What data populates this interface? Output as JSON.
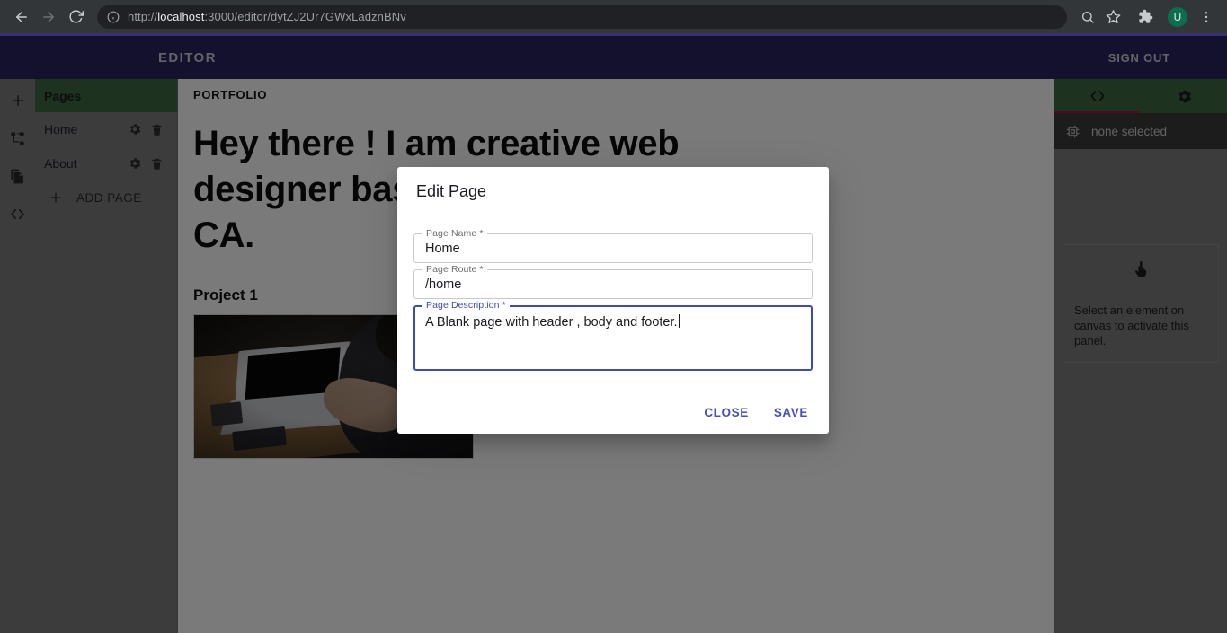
{
  "browser": {
    "back_icon": "back-arrow-icon",
    "forward_icon": "forward-arrow-icon",
    "reload_icon": "reload-icon",
    "site_info_icon": "info-circle-icon",
    "url_prefix": "http://",
    "url_host": "localhost",
    "url_rest": ":3000/editor/dytZJ2Ur7GWxLadznBNv",
    "url_full": "http://localhost:3000/editor/dytZJ2Ur7GWxLadznBNv",
    "search_icon": "search-icon",
    "bookmark_icon": "star-icon",
    "extensions_icon": "puzzle-piece-icon",
    "profile_initial": "U",
    "menu_icon": "kebab-menu-icon",
    "accent_color": "#3b3170",
    "toolbar_color": "#323639"
  },
  "app_header": {
    "title": "EDITOR",
    "sign_out_label": "SIGN OUT",
    "background": "#2b2560"
  },
  "icon_rail": {
    "items": [
      {
        "name": "add-icon",
        "label": "Add"
      },
      {
        "name": "sitemap-icon",
        "label": "Layers"
      },
      {
        "name": "file-copy-icon",
        "label": "Pages"
      },
      {
        "name": "code-icon",
        "label": "Code"
      }
    ]
  },
  "pages_panel": {
    "header": "Pages",
    "header_color": "#3e6b41",
    "pages": [
      {
        "name": "Home",
        "settings_icon": "gear-icon",
        "delete_icon": "trash-icon"
      },
      {
        "name": "About",
        "settings_icon": "gear-icon",
        "delete_icon": "trash-icon"
      }
    ],
    "add_page_label": "ADD PAGE",
    "add_page_icon": "plus-icon"
  },
  "canvas": {
    "section_label": "PORTFOLIO",
    "heading": "Hey there ! I am creative web designer based on San Francisco, CA.",
    "project_title": "Project 1",
    "project_image_alt": "person-working-on-laptop-photo"
  },
  "right_panel": {
    "tabs": [
      {
        "name": "code-tab",
        "icon": "code-icon",
        "active": true
      },
      {
        "name": "settings-tab",
        "icon": "gear-icon",
        "active": false
      }
    ],
    "tab_indicator_color": "#a8174a",
    "selection_icon": "chip-icon",
    "selection_text": "none selected",
    "placeholder_icon": "touch-pointer-icon",
    "placeholder_text": "Select an element on canvas to activate this panel."
  },
  "dialog": {
    "title": "Edit Page",
    "accent_color": "#3f4bb0",
    "fields": [
      {
        "label": "Page Name *",
        "value": "Home",
        "placeholder": "Page Name",
        "focused": false,
        "type": "text"
      },
      {
        "label": "Page Route *",
        "value": "/home",
        "placeholder": "Page Route",
        "focused": false,
        "type": "text"
      },
      {
        "label": "Page Description *",
        "value": "A Blank page with header , body and footer.",
        "placeholder": "Page Description",
        "focused": true,
        "type": "textarea"
      }
    ],
    "close_label": "CLOSE",
    "save_label": "SAVE"
  }
}
